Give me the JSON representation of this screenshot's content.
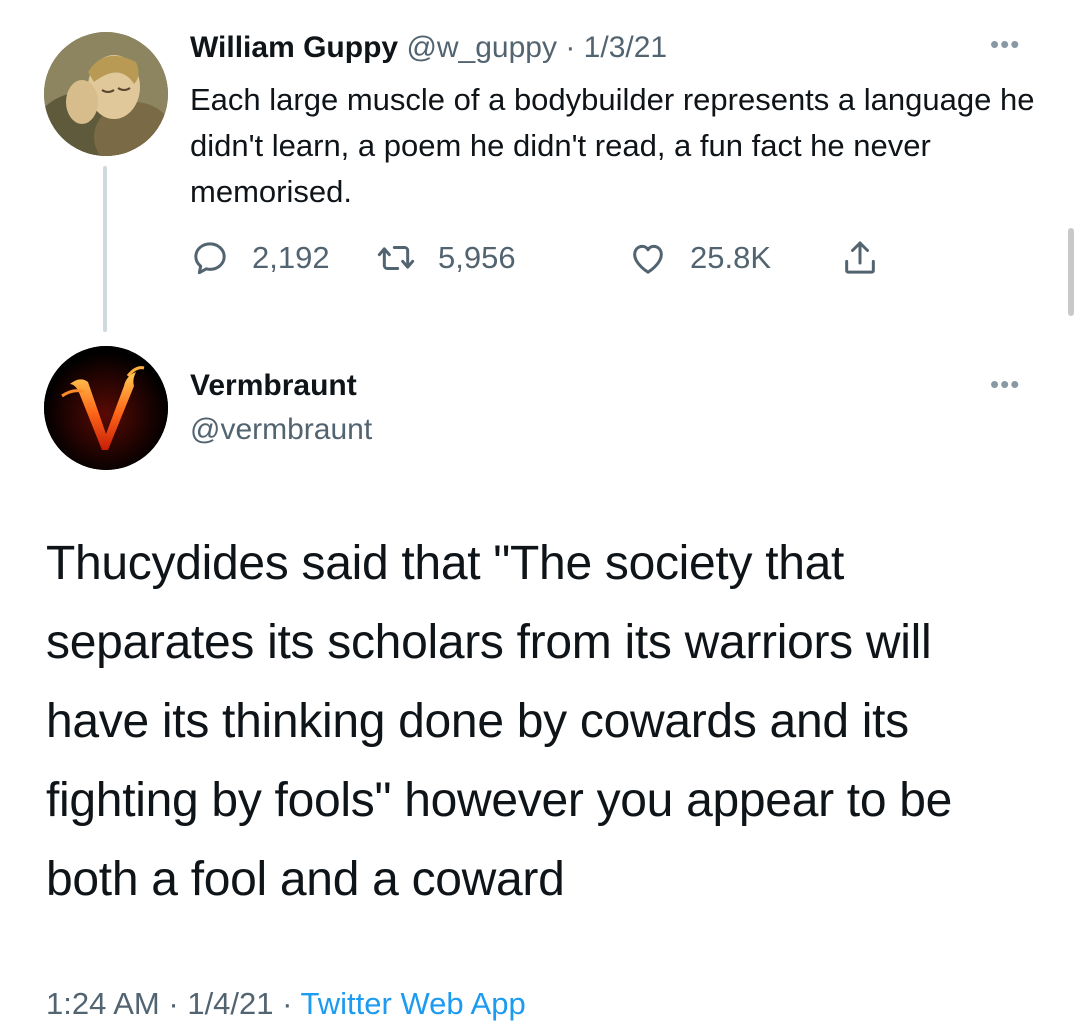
{
  "original_tweet": {
    "author_name": "William Guppy",
    "author_handle": "@w_guppy",
    "separator": "·",
    "date": "1/3/21",
    "text": "Each large muscle of a bodybuilder represents a language he didn't learn, a poem he didn't read, a fun fact he never memorised.",
    "more_label": "•••",
    "actions": {
      "reply_count": "2,192",
      "retweet_count": "5,956",
      "like_count": "25.8K"
    }
  },
  "reply_tweet": {
    "author_name": "Vermbraunt",
    "author_handle": "@vermbraunt",
    "more_label": "•••",
    "text": "Thucydides said that \"The society that separates its scholars from its warriors will have its thinking done by cowards and its fighting by fools\" however you appear to be both a fool and a coward",
    "time": "1:24 AM",
    "separator": "·",
    "date": "1/4/21",
    "source": "Twitter Web App"
  },
  "colors": {
    "text_primary": "#0f1419",
    "text_muted": "#536471",
    "link": "#1d9bf0",
    "thread_line": "#cfd9de"
  },
  "icons": {
    "reply": "reply-icon",
    "retweet": "retweet-icon",
    "like": "heart-icon",
    "share": "share-icon",
    "more": "more-icon"
  }
}
